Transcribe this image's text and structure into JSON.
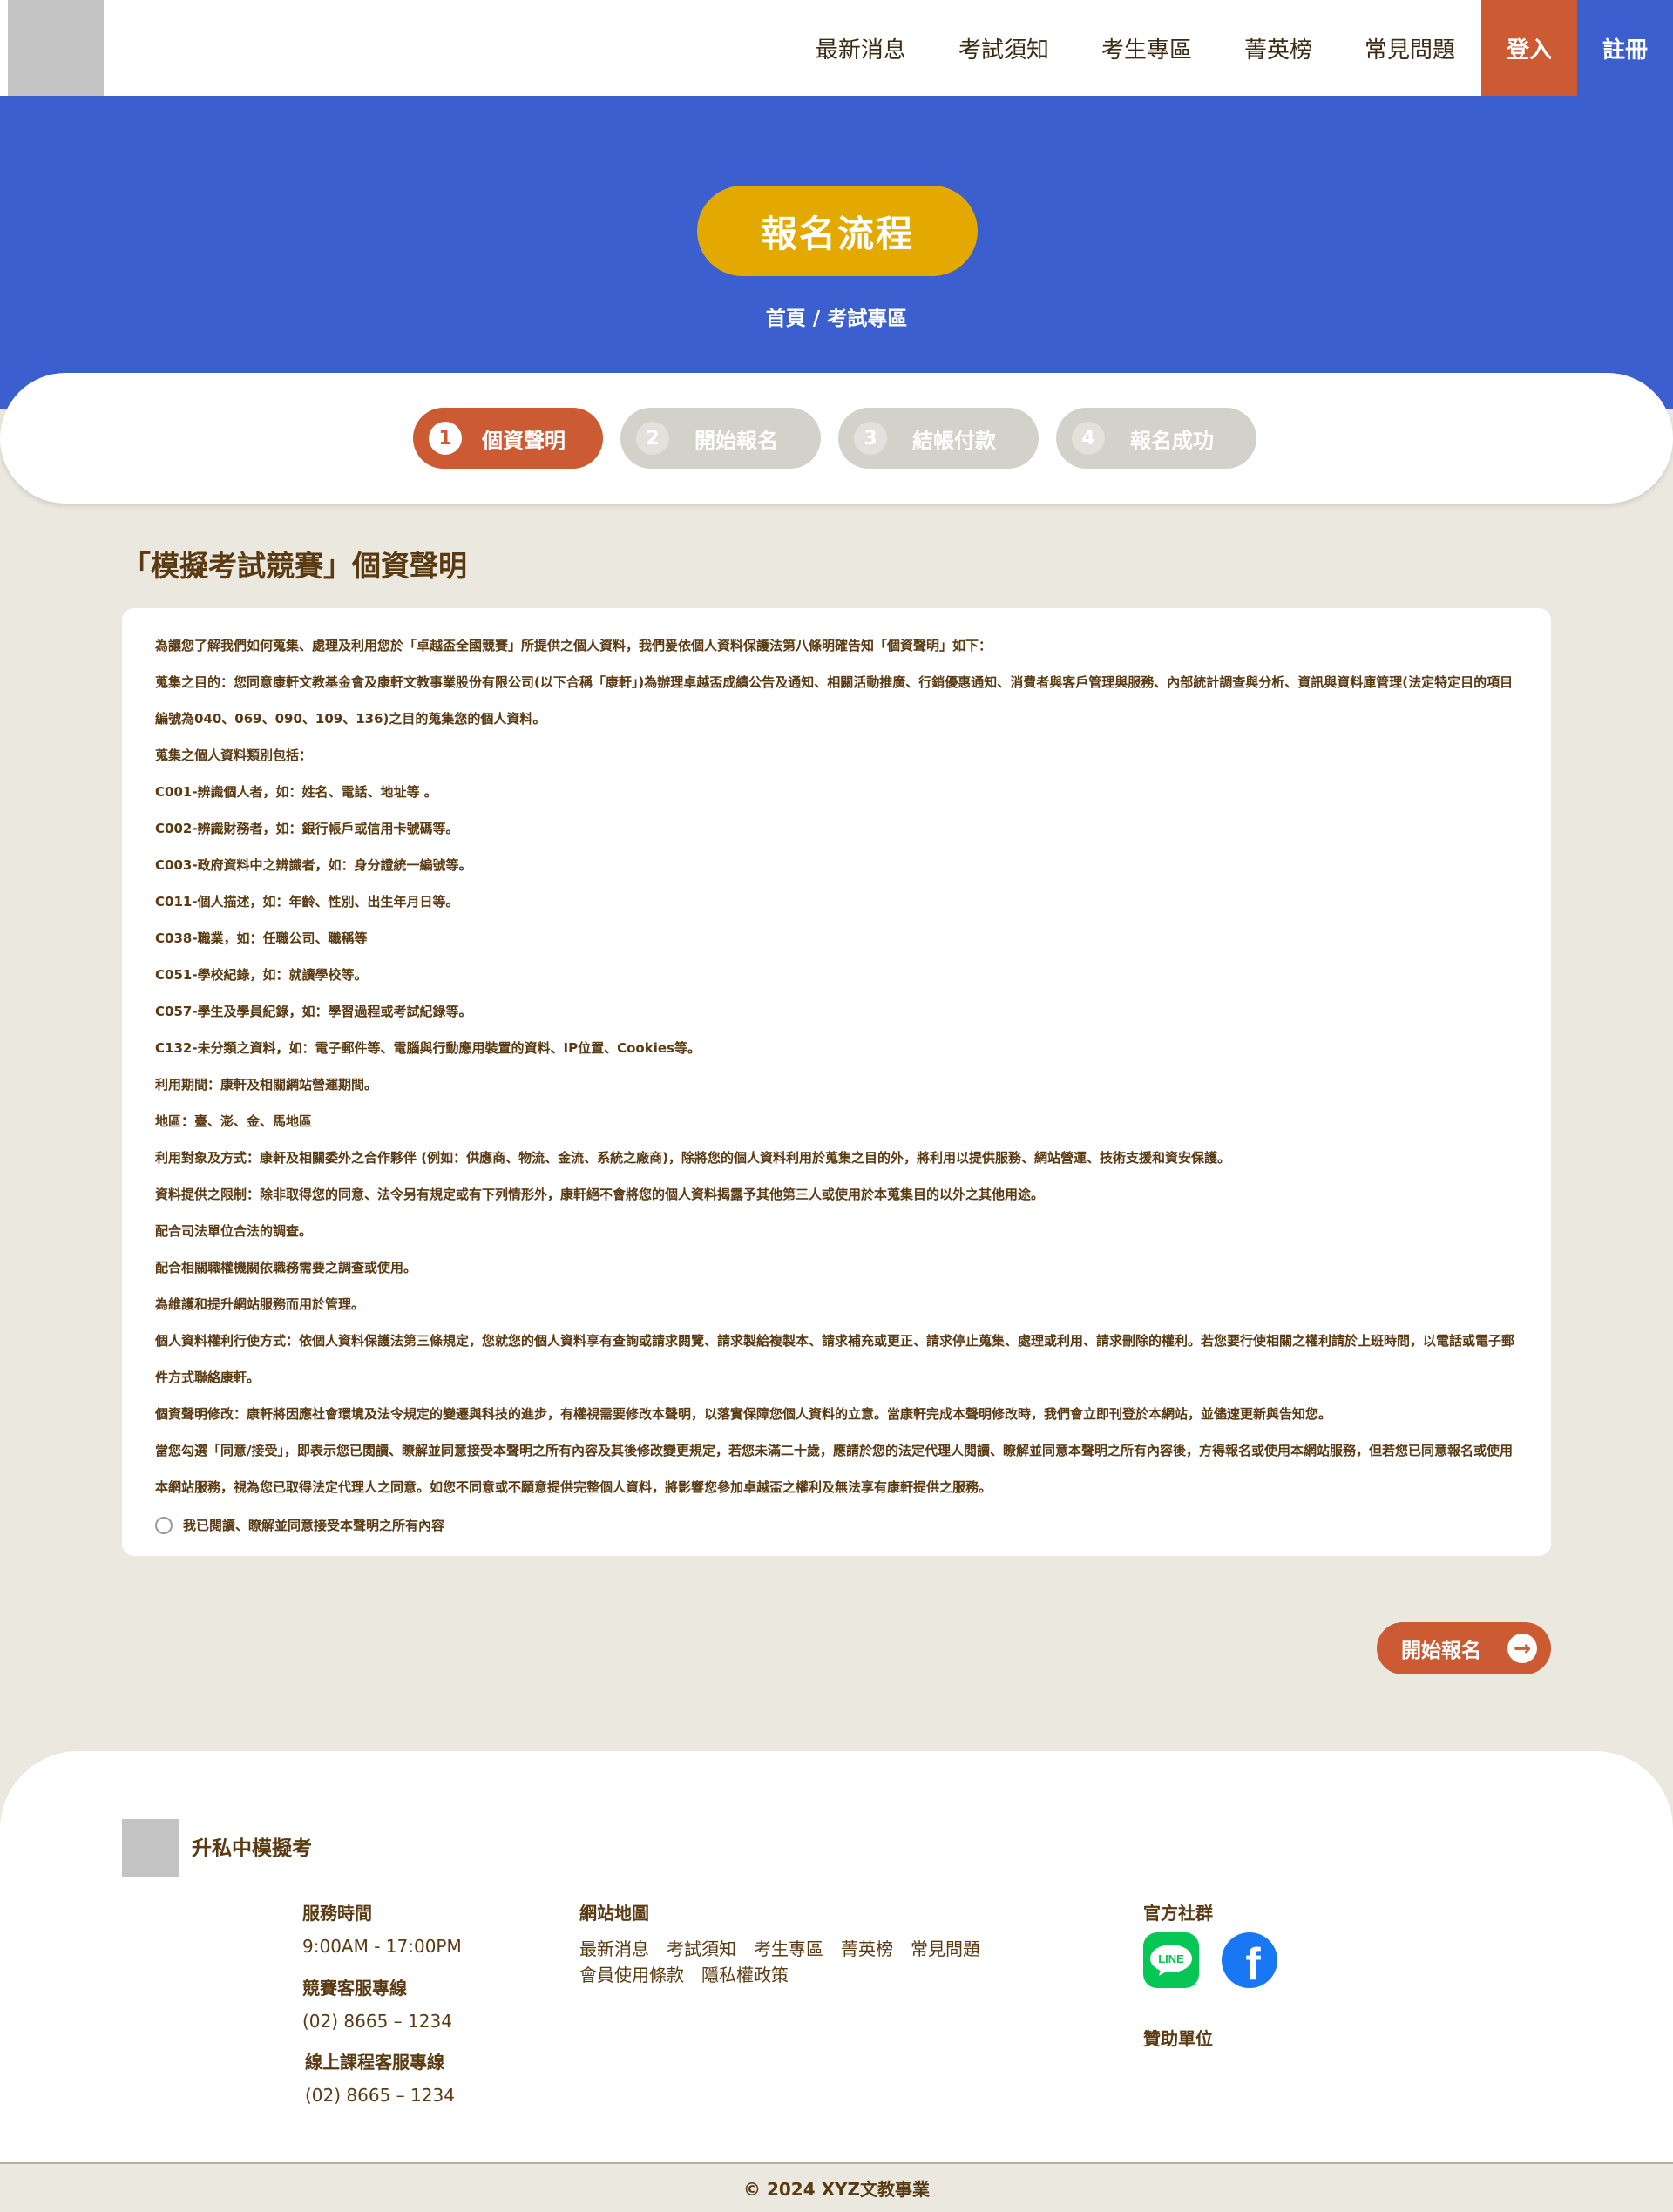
{
  "header": {
    "nav": [
      "最新消息",
      "考試須知",
      "考生專區",
      "菁英榜",
      "常見問題"
    ],
    "login_label": "登入",
    "register_label": "註冊"
  },
  "hero": {
    "title": "報名流程",
    "breadcrumb": "首頁 / 考試專區"
  },
  "steps": [
    {
      "num": "1",
      "label": "個資聲明",
      "active": true
    },
    {
      "num": "2",
      "label": "開始報名",
      "active": false
    },
    {
      "num": "3",
      "label": "結帳付款",
      "active": false
    },
    {
      "num": "4",
      "label": "報名成功",
      "active": false
    }
  ],
  "section": {
    "title": "「模擬考試競賽」個資聲明",
    "paragraphs": [
      "為讓您了解我們如何蒐集、處理及利用您於「卓越盃全國競賽」所提供之個人資料，我們爰依個人資料保護法第八條明確告知「個資聲明」如下：",
      "蒐集之目的：您同意康軒文教基金會及康軒文教事業股份有限公司(以下合稱「康軒」)為辦理卓越盃成績公告及通知、相關活動推廣、行銷優惠通知、消費者與客戶管理與服務、內部統計調查與分析、資訊與資料庫管理(法定特定目的項目編號為040、069、090、109、136)之目的蒐集您的個人資料。",
      "蒐集之個人資料類別包括：",
      "C001-辨識個人者，如：姓名、電話、地址等 。",
      "C002-辨識財務者，如：銀行帳戶或信用卡號碼等。",
      "C003-政府資料中之辨識者，如：身分證統一編號等。",
      "C011-個人描述，如：年齡、性別、出生年月日等。",
      "C038-職業，如：任職公司、職稱等",
      "C051-學校紀錄，如：就讀學校等。",
      "C057-學生及學員紀錄，如：學習過程或考試紀錄等。",
      "C132-未分類之資料，如：電子郵件等、電腦與行動應用裝置的資料、IP位置、Cookies等。",
      "利用期間：康軒及相關網站營運期間。",
      "地區：臺、澎、金、馬地區",
      "利用對象及方式：康軒及相關委外之合作夥伴 (例如：供應商、物流、金流、系統之廠商)，除將您的個人資料利用於蒐集之目的外，將利用以提供服務、網站營運、技術支援和資安保護。",
      "資料提供之限制：除非取得您的同意、法令另有規定或有下列情形外，康軒絕不會將您的個人資料揭露予其他第三人或使用於本蒐集目的以外之其他用途。",
      "配合司法單位合法的調查。",
      "配合相關職權機關依職務需要之調查或使用。",
      "為維護和提升網站服務而用於管理。",
      "個人資料權利行使方式：依個人資料保護法第三條規定，您就您的個人資料享有查詢或請求閱覽、請求製給複製本、請求補充或更正、請求停止蒐集、處理或利用、請求刪除的權利。若您要行使相關之權利請於上班時間，以電話或電子郵件方式聯絡康軒。",
      "個資聲明修改：康軒將因應社會環境及法令規定的變遷與科技的進步，有權視需要修改本聲明，以落實保障您個人資料的立意。當康軒完成本聲明修改時，我們會立即刊登於本網站，並儘速更新與告知您。",
      "當您勾選「同意/接受」，即表示您已閱讀、瞭解並同意接受本聲明之所有內容及其後修改變更規定，若您未滿二十歲，應請於您的法定代理人閱讀、瞭解並同意本聲明之所有內容後，方得報名或使用本網站服務，但若您已同意報名或使用本網站服務，視為您已取得法定代理人之同意。如您不同意或不願意提供完整個人資料，將影響您參加卓越盃之權利及無法享有康軒提供之服務。"
    ],
    "agree_label": "我已閱讀、瞭解並同意接受本聲明之所有內容"
  },
  "start_button": "開始報名",
  "footer": {
    "brand": "升私中模擬考",
    "service_hours_label": "服務時間",
    "service_hours": "9:00AM - 17:00PM",
    "hotline_label": "競賽客服專線",
    "hotline": "(02) 8665 – 1234",
    "online_hotline_label": "線上課程客服專線",
    "online_hotline": "(02) 8665 – 1234",
    "sitemap_label": "網站地圖",
    "sitemap_links": [
      "最新消息",
      "考試須知",
      "考生專區",
      "菁英榜",
      "常見問題",
      "會員使用條款",
      "隱私權政策"
    ],
    "social_label": "官方社群",
    "social": {
      "line_text": "LINE",
      "facebook_text": "f"
    },
    "sponsor_label": "贊助單位",
    "copyright": "© 2024 XYZ文教事業"
  },
  "colors": {
    "primary_blue": "#3b5fce",
    "accent_orange": "#cc5a33",
    "gold": "#e3a900",
    "beige_bg": "#ebe9df",
    "text_brown": "#5a3a12"
  }
}
